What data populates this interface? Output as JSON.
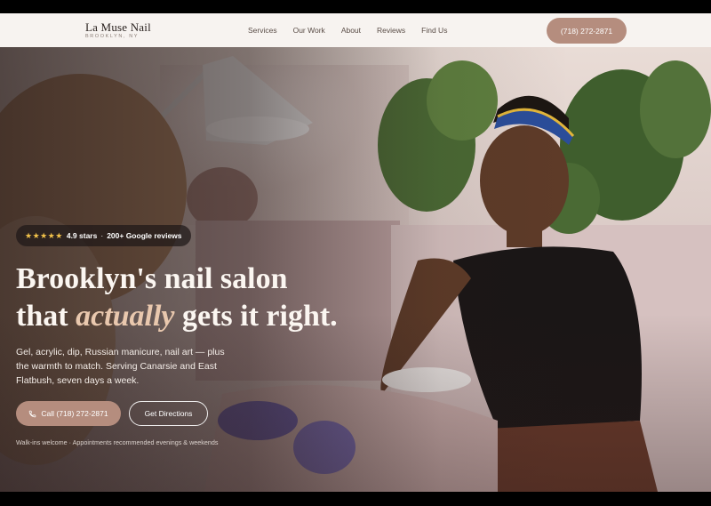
{
  "brand": {
    "name": "La Muse Nail",
    "location": "BROOKLYN, NY"
  },
  "nav": {
    "items": [
      "Services",
      "Our Work",
      "About",
      "Reviews",
      "Find Us"
    ]
  },
  "header": {
    "phone": "(718) 272-2871"
  },
  "hero": {
    "rating_badge": {
      "stars": "★★★★★",
      "rating": "4.9 stars",
      "separator": "·",
      "reviews": "200+ Google reviews"
    },
    "headline_line1": "Brooklyn's nail salon",
    "headline_line2_start": "that",
    "headline_line2_accent": "actually",
    "headline_line2_end": "gets it right.",
    "subtext": "Gel, acrylic, dip, Russian manicure, nail art — plus the warmth to match. Serving Canarsie and East Flatbush, seven days a week.",
    "call_button": "Call (718) 272-2871",
    "directions_button": "Get Directions",
    "note": "Walk-ins welcome · Appointments recommended evenings & weekends"
  },
  "colors": {
    "accent": "#b58d7e",
    "header_bg": "#f7f3f0",
    "headline_accent": "#e9c8ae",
    "star": "#f2c24a"
  },
  "icons": {
    "call": "phone-icon",
    "star": "star-icon"
  }
}
